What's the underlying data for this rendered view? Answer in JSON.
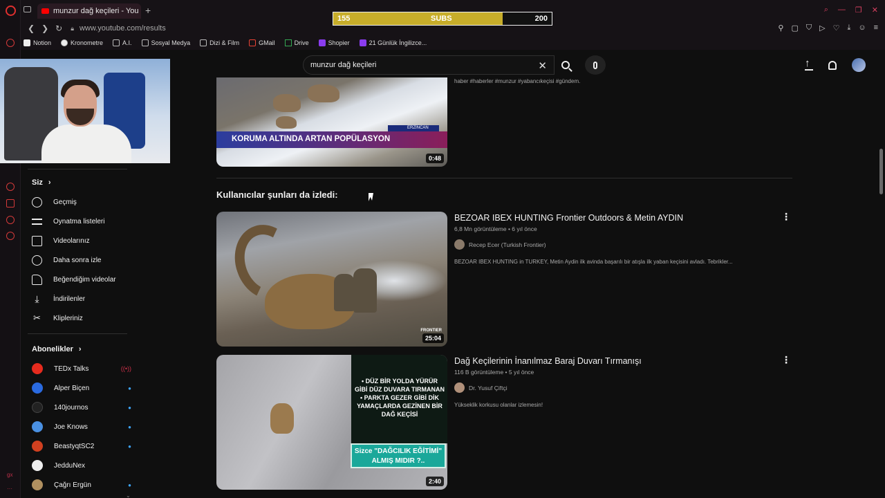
{
  "browser": {
    "tab_title": "munzur dağ keçileri - You",
    "url": "www.youtube.com/results",
    "bookmarks": [
      "Notion",
      "Kronometre",
      "A.I.",
      "Sosyal Medya",
      "Dizi & Film",
      "GMail",
      "Drive",
      "Shopier",
      "21 Günlük İngilizce..."
    ]
  },
  "subs_widget": {
    "current": "155",
    "label": "SUBS",
    "goal": "200",
    "progress_fraction": 0.775,
    "fill_color": "#c7ad2a"
  },
  "search": {
    "query": "munzur dağ keçileri"
  },
  "sidebar": {
    "you_label": "Siz",
    "you_items": [
      {
        "label": "Geçmiş",
        "icon": "history-icon"
      },
      {
        "label": "Oynatma listeleri",
        "icon": "playlist-icon"
      },
      {
        "label": "Videolarınız",
        "icon": "your-videos-icon"
      },
      {
        "label": "Daha sonra izle",
        "icon": "watch-later-icon"
      },
      {
        "label": "Beğendiğim videolar",
        "icon": "like-icon"
      },
      {
        "label": "İndirilenler",
        "icon": "download-icon"
      },
      {
        "label": "Klipleriniz",
        "icon": "clips-icon"
      }
    ],
    "subs_label": "Abonelikler",
    "channels": [
      {
        "name": "TEDx Talks",
        "status": "live",
        "color": "#e62b1e"
      },
      {
        "name": "Alper Biçen",
        "status": "new",
        "color": "#2a6ae0"
      },
      {
        "name": "140journos",
        "status": "new",
        "color": "#222222"
      },
      {
        "name": "Joe Knows",
        "status": "new",
        "color": "#4a90e2"
      },
      {
        "name": "BeastyqtSC2",
        "status": "new",
        "color": "#d04020"
      },
      {
        "name": "JedduNex",
        "status": "",
        "color": "#eeeeee"
      },
      {
        "name": "Çağrı Ergün",
        "status": "new",
        "color": "#b09060"
      }
    ]
  },
  "results": {
    "top_video": {
      "desc": "haber #haberler #munzur #yabancıkeçisi #gündem.",
      "duration": "0:48",
      "banner_text": "KORUMA ALTINDA ARTAN POPÜLASYON",
      "banner_tag": "ERZİNCAN"
    },
    "shelf_title": "Kullanıcılar şunları da izledi:",
    "videos": [
      {
        "title": "BEZOAR IBEX HUNTING Frontier Outdoors & Metin AYDIN",
        "stats": "6,8 Mn görüntüleme • 6 yıl önce",
        "channel": "Recep Ecer (Turkish Frontier)",
        "desc": "BEZOAR IBEX HUNTING in TURKEY, Metin Aydin ilk avinda başarılı bir atışla ilk yaban keçisini avladı. Tebrikler...",
        "duration": "25:04",
        "thumb_brand": "FRONTIER"
      },
      {
        "title": "Dağ Keçilerinin İnanılmaz Baraj Duvarı Tırmanışı",
        "stats": "116 B görüntüleme • 5 yıl önce",
        "channel": "Dr. Yusuf Çiftçi",
        "desc": "Yükseklik korkusu olanlar izlemesin!",
        "duration": "2:40",
        "thumb_text": "• DÜZ BİR YOLDA YÜRÜR GİBİ DÜZ DUVARA TIRMANAN • PARKTA GEZER GİBİ DİK YAMAÇLARDA GEZİNEN BİR DAĞ KEÇİSİ",
        "thumb_question": "Sizce \"DAĞCILIK EĞİTİMİ\" ALMIŞ MIDIR ?.."
      }
    ]
  }
}
